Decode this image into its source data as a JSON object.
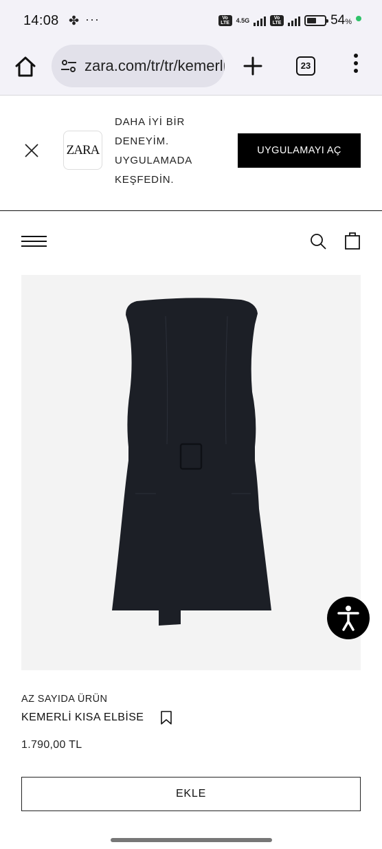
{
  "status_bar": {
    "time": "14:08",
    "network_label": "4.5G",
    "volte_label": "Vo LTE",
    "battery_percent": "54",
    "battery_unit": "%",
    "battery_level": 0.54,
    "charge_color": "#2fc36a"
  },
  "browser": {
    "url": "zara.com/tr/tr/kemerli-kisa",
    "tab_count": "23"
  },
  "app_banner": {
    "logo_text": "ZARA",
    "lines": [
      "DAHA İYİ BİR",
      "DENEYİM.",
      "UYGULAMADA",
      "KEŞFEDİN."
    ],
    "open_app_label": "UYGULAMAYI AÇ"
  },
  "product": {
    "stock_label": "AZ SAYIDA ÜRÜN",
    "name": "KEMERLİ KISA ELBİSE",
    "price": "1.790,00 TL",
    "add_label": "EKLE",
    "image_bg": "#f3f3f3",
    "dress_color": "#1c1f26"
  }
}
